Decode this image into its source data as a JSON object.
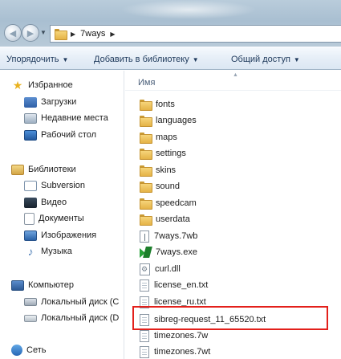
{
  "address": {
    "crumb": "7ways"
  },
  "commands": {
    "organize": "Упорядочить",
    "add_library": "Добавить в библиотеку",
    "share": "Общий доступ"
  },
  "nav": {
    "favorites": "Избранное",
    "downloads": "Загрузки",
    "recent": "Недавние места",
    "desktop": "Рабочий стол",
    "libraries": "Библиотеки",
    "subversion": "Subversion",
    "video": "Видео",
    "documents": "Документы",
    "images": "Изображения",
    "music": "Музыка",
    "computer": "Компьютер",
    "disk_c": "Локальный диск (C",
    "disk_d": "Локальный диск (D",
    "network": "Сеть"
  },
  "content": {
    "column_name": "Имя",
    "files": [
      "fonts",
      "languages",
      "maps",
      "settings",
      "skins",
      "sound",
      "speedcam",
      "userdata",
      "7ways.7wb",
      "7ways.exe",
      "curl.dll",
      "license_en.txt",
      "license_ru.txt",
      "sibreg-request_11_65520.txt",
      "timezones.7w",
      "timezones.7wt"
    ]
  },
  "highlight": {
    "color": "#e3201b"
  }
}
